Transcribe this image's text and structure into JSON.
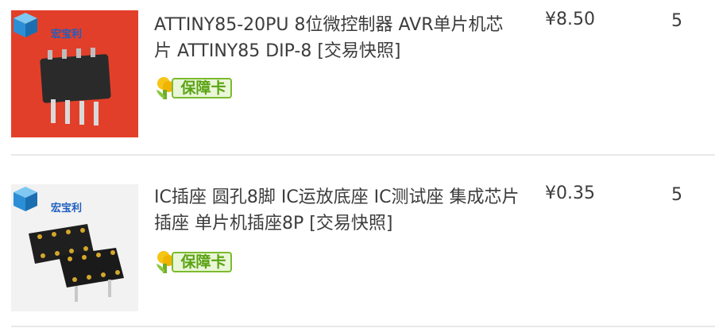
{
  "items": [
    {
      "title": "ATTINY85-20PU 8位微控制器 AVR单片机芯片 ATTINY85 DIP-8 [交易快照]",
      "badge": "保障卡",
      "price": "¥8.50",
      "quantity": "5",
      "shop_label": "宏宝利"
    },
    {
      "title": "IC插座 圆孔8脚 IC运放底座 IC测试座 集成芯片插座 单片机插座8P [交易快照]",
      "badge": "保障卡",
      "price": "¥0.35",
      "quantity": "5",
      "shop_label": "宏宝利"
    }
  ],
  "colors": {
    "badge_green": "#5aa313",
    "thumb_red": "#e8412c",
    "divider": "#e8e8e8"
  },
  "icons": [
    "brand-cube-icon",
    "guarantee-card-icon"
  ]
}
